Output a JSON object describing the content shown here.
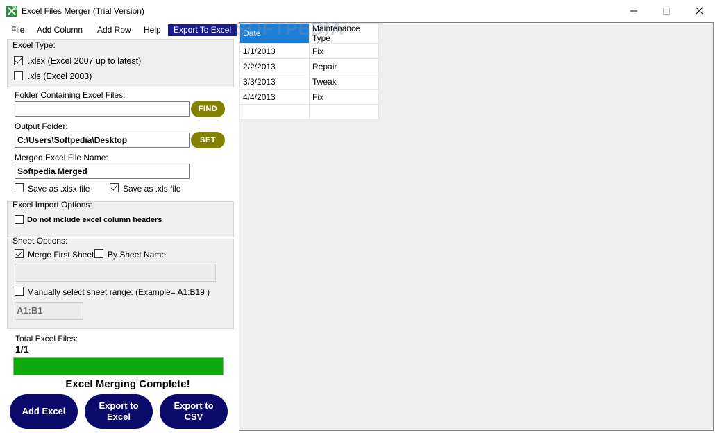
{
  "window": {
    "title": "Excel Files Merger (Trial Version)",
    "icon": "excel-merger-icon",
    "controls": [
      "minimize-icon",
      "maximize-icon",
      "close-icon"
    ]
  },
  "menu": {
    "file": "File",
    "add_column": "Add Column",
    "add_row": "Add Row",
    "help": "Help",
    "export_to_excel": "Export To Excel"
  },
  "excel_type": {
    "title": "Excel Type:",
    "xlsx_label": ".xlsx (Excel 2007 up to latest)",
    "xlsx_checked": true,
    "xls_label": ".xls (Excel 2003)",
    "xls_checked": false
  },
  "folders": {
    "input_label": "Folder Containing Excel Files:",
    "input_value": "",
    "find_button": "FIND",
    "output_label": "Output Folder:",
    "output_value": "C:\\Users\\Softpedia\\Desktop",
    "set_button": "SET",
    "merged_name_label": "Merged Excel File Name:",
    "merged_name_value": "Softpedia Merged",
    "save_xlsx_label": "Save as .xlsx file",
    "save_xlsx_checked": false,
    "save_xls_label": "Save as .xls file",
    "save_xls_checked": true
  },
  "import_options": {
    "title": "Excel Import Options:",
    "no_headers_label": "Do not include excel column headers",
    "no_headers_checked": false
  },
  "sheet_options": {
    "title": "Sheet Options:",
    "merge_first_label": "Merge First Sheet",
    "merge_first_checked": true,
    "by_name_label": "By Sheet Name",
    "by_name_checked": false,
    "sheet_name_value": "",
    "manual_range_label": "Manually select sheet range: (Example=  A1:B19 )",
    "manual_range_checked": false,
    "range_value": "A1:B1"
  },
  "status": {
    "total_label": "Total Excel Files:",
    "total_value": "1/1",
    "progress": 1.0,
    "progress_color": "#0ea90e",
    "message": "Excel Merging Complete!"
  },
  "actions": {
    "add_excel": "Add Excel",
    "export_excel_line1": "Export to",
    "export_excel_line2": "Excel",
    "export_csv_line1": "Export to",
    "export_csv_line2": "CSV"
  },
  "grid": {
    "watermark": "SOFTPEDIA",
    "headers": [
      "Date",
      "Maintenance Type"
    ],
    "rows": [
      [
        "1/1/2013",
        "Fix"
      ],
      [
        "2/2/2013",
        "Repair"
      ],
      [
        "3/3/2013",
        "Tweak"
      ],
      [
        "4/4/2013",
        "Fix"
      ],
      [
        "",
        ""
      ]
    ]
  },
  "colors": {
    "accent_button": "#828200",
    "action_button": "#0b0b6b",
    "menu_highlight": "#1a1a8a",
    "selected_header": "#1e7fd6"
  }
}
